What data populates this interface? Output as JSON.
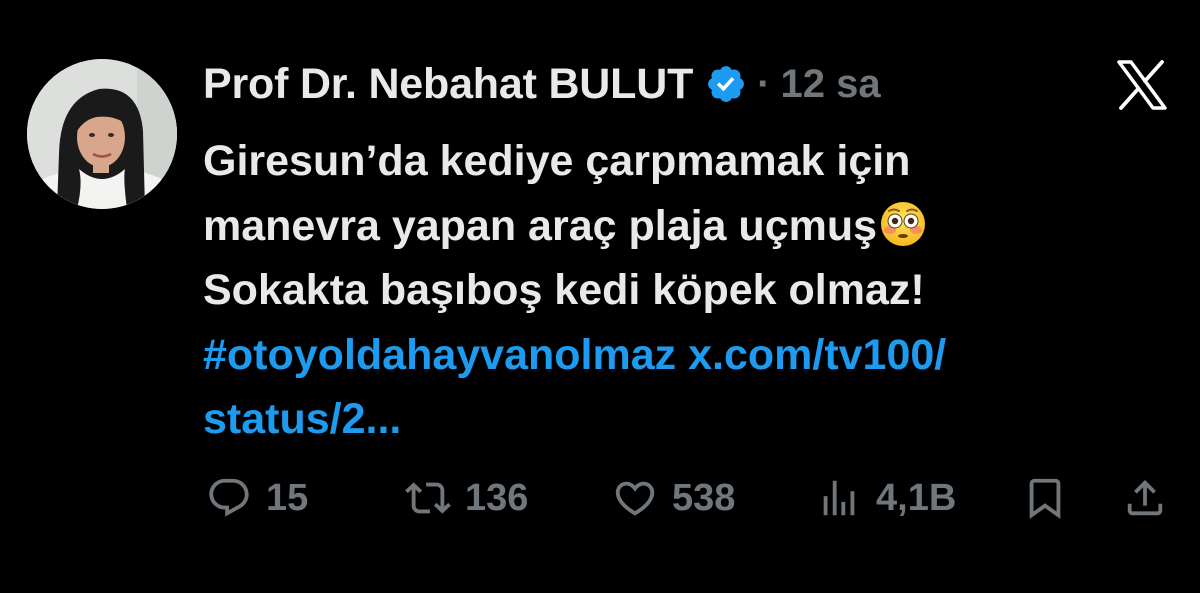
{
  "author": {
    "name": "Prof Dr. Nebahat BULUT",
    "verified": true,
    "separator": "·",
    "time": "12 sa"
  },
  "tweet": {
    "lines": [
      "Giresun’da kediye çarpmamak için",
      "manevra yapan araç plaja uçmuş",
      "Sokakta başıboş kedi köpek olmaz!"
    ],
    "hashtag": "#otoyoldahayvanolmaz",
    "link_part1": "x.com/tv100/",
    "link_part2": "status/2..."
  },
  "actions": {
    "replies": "15",
    "reposts": "136",
    "likes": "538",
    "views": "4,1B"
  },
  "icons": {
    "verified": "verified-badge-icon",
    "logo": "x-logo-icon",
    "reply": "reply-icon",
    "repost": "repost-icon",
    "like": "heart-icon",
    "views": "views-icon",
    "bookmark": "bookmark-icon",
    "share": "share-icon",
    "emoji": "flushed-face-emoji"
  },
  "colors": {
    "background": "#000000",
    "text": "#e7e9ea",
    "muted": "#71767b",
    "link": "#1d9bf0"
  }
}
